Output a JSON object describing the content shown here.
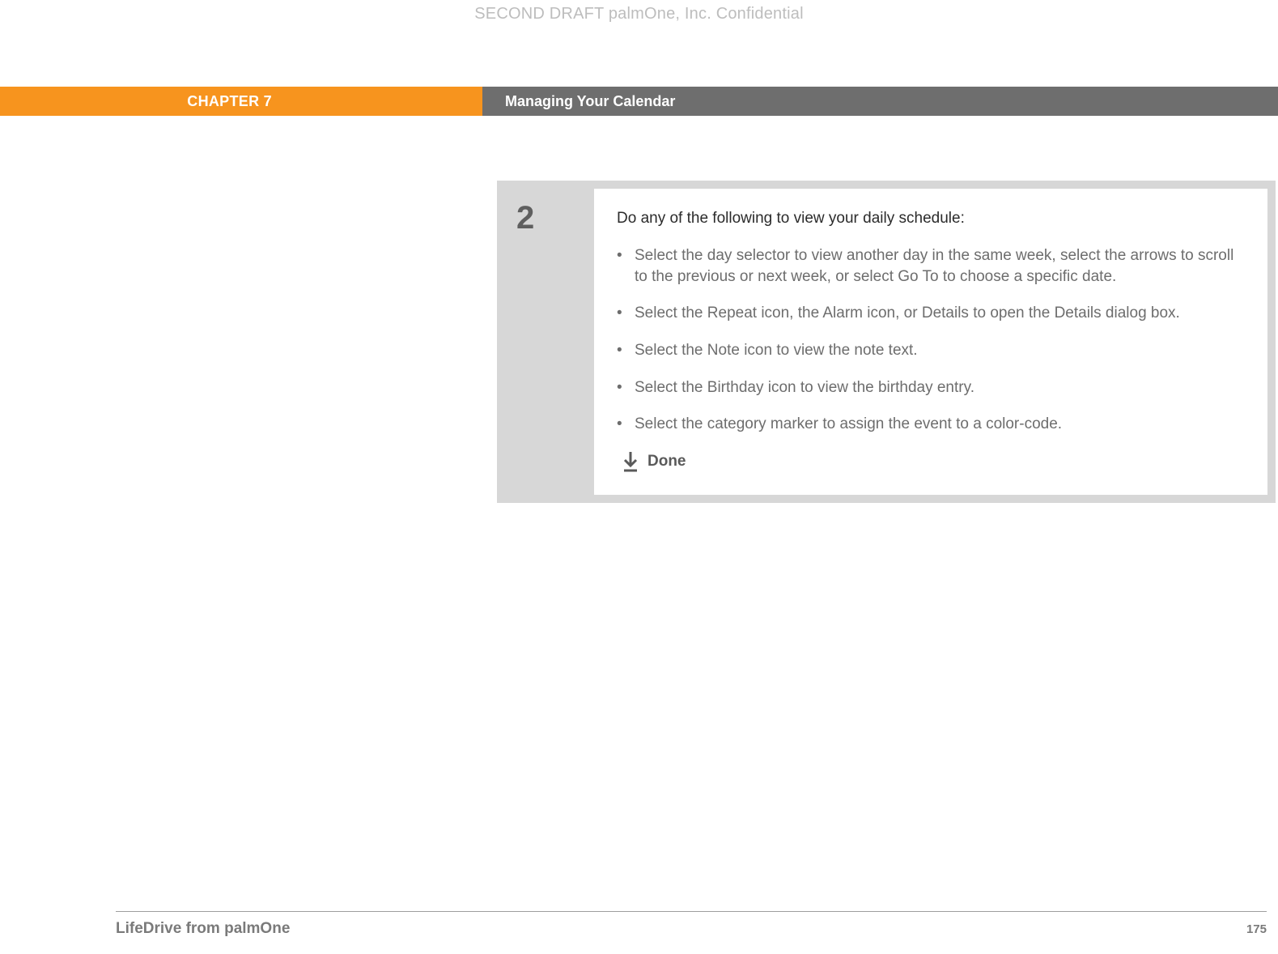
{
  "watermark": "SECOND DRAFT palmOne, Inc.  Confidential",
  "header": {
    "chapter": "CHAPTER 7",
    "title": "Managing Your Calendar"
  },
  "step": {
    "number": "2",
    "intro": "Do any of the following to view your daily schedule:",
    "bullets": [
      "Select the day selector to view another day in the same week, select the arrows to scroll to the previous or next week, or select Go To to choose a specific date.",
      "Select the Repeat icon, the Alarm icon, or Details to open the Details dialog box.",
      "Select the Note icon to view the note text.",
      "Select the Birthday icon to view the birthday entry.",
      "Select the category marker to assign the event to a color-code."
    ],
    "done": "Done"
  },
  "footer": {
    "product": "LifeDrive from palmOne",
    "page": "175"
  }
}
